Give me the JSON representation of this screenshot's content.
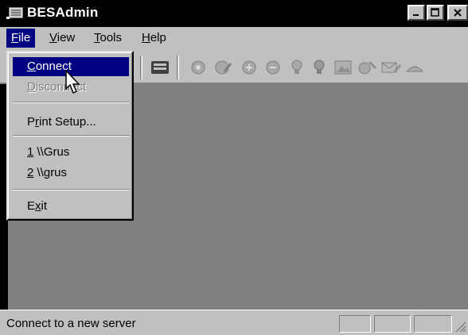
{
  "window": {
    "title": "BESAdmin"
  },
  "menubar": {
    "items": [
      {
        "label": "File",
        "accel": "F",
        "rest": "ile"
      },
      {
        "label": "View",
        "accel": "V",
        "rest": "iew"
      },
      {
        "label": "Tools",
        "accel": "T",
        "rest": "ools"
      },
      {
        "label": "Help",
        "accel": "H",
        "rest": "elp"
      }
    ]
  },
  "file_menu": {
    "connect": {
      "accel": "C",
      "rest": "onnect"
    },
    "disconnect": {
      "accel": "D",
      "rest": "isconnect"
    },
    "print_setup": {
      "pre": "P",
      "accel": "r",
      "rest": "int Setup..."
    },
    "recent_1": {
      "accel": "1",
      "rest": " \\\\Grus"
    },
    "recent_2": {
      "accel": "2",
      "rest": " \\\\grus"
    },
    "exit": {
      "pre": "E",
      "accel": "x",
      "rest": "it"
    }
  },
  "status": {
    "text": "Connect to a new server"
  },
  "colors": {
    "titlebar": "#000000",
    "menu_highlight": "#000080",
    "workspace": "#808080",
    "chrome": "#c0c0c0"
  }
}
